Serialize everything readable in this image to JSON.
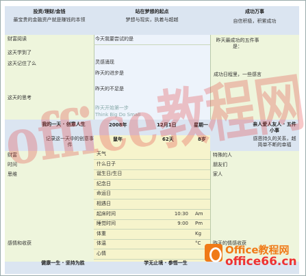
{
  "sections": {
    "left_title": "投资/理财/金钱",
    "left_sub": "最宝贵的金融资产就是赚钱的本领",
    "center_title": "站在梦想的起点",
    "center_sub": "梦想与现实，执着与超越",
    "right_title": "成功万事",
    "right_sub": "自信积极，积累成功"
  },
  "left_labels": [
    "财富阅读",
    "这天学到了",
    "这天记住了么",
    "这天的思考"
  ],
  "center_prompts": [
    "今天我要尝试的是",
    "灵感涌现",
    "昨天的进步是",
    "昨天的不足是"
  ],
  "center_quote": [
    "昨天开始第一步",
    "Think Big Do Small"
  ],
  "right_notes": [
    "昨天最成功的五件事是：",
    "成功日程里，一些感言"
  ],
  "day_band": {
    "left_title": "我的一天 · 创意人生",
    "left_sub": "记录这一天中的创意事件",
    "year": "2008年",
    "date": "12月1日",
    "weekday": "星期一",
    "right_title": "亲人爱人友人 · 五件小事",
    "right_sub": "感恩持久的关系，越简单不断的幸福"
  },
  "zodiac": {
    "animal": "鼠年",
    "days": "62天",
    "age": "8岁"
  },
  "left_mid_labels": [
    "财富",
    "时间",
    "思维"
  ],
  "center_fields": [
    {
      "label": "天气",
      "value": "",
      "unit": ""
    },
    {
      "label": "什么日子",
      "value": "",
      "unit": ""
    },
    {
      "label": "诞生日/生日",
      "value": "",
      "unit": ""
    },
    {
      "label": "纪念日",
      "value": "",
      "unit": ""
    },
    {
      "label": "命运日",
      "value": "",
      "unit": ""
    },
    {
      "label": "相遇日",
      "value": "",
      "unit": ""
    },
    {
      "label": "起床时间",
      "value": "10:30",
      "unit": "Am"
    },
    {
      "label": "睡觉时间",
      "value": "9:00",
      "unit": "Pm"
    },
    {
      "label": "体重",
      "value": "",
      "unit": "Kg"
    },
    {
      "label": "体温",
      "value": "",
      "unit": "°C"
    },
    {
      "label": "心情",
      "value": "",
      "unit": ""
    }
  ],
  "right_mid_labels": [
    "特殊的人",
    "朋友们",
    "家人"
  ],
  "left_bottom_label": "感情和收获",
  "right_bottom_label": "昨天的情感收获",
  "footer": {
    "left_title": "健康一生 · 坚持为胜",
    "left_sub": "...",
    "center_title": "学无止境 · 参悟一生",
    "center_sub": "...",
    "right_sub": "..."
  },
  "watermark": "office教程网",
  "logo": {
    "line1": "Office教程网",
    "line2": "office66.cn"
  },
  "colors": {
    "accent": "#f07a17",
    "band": "#dbe5f1",
    "panel": "#eef5dc"
  }
}
